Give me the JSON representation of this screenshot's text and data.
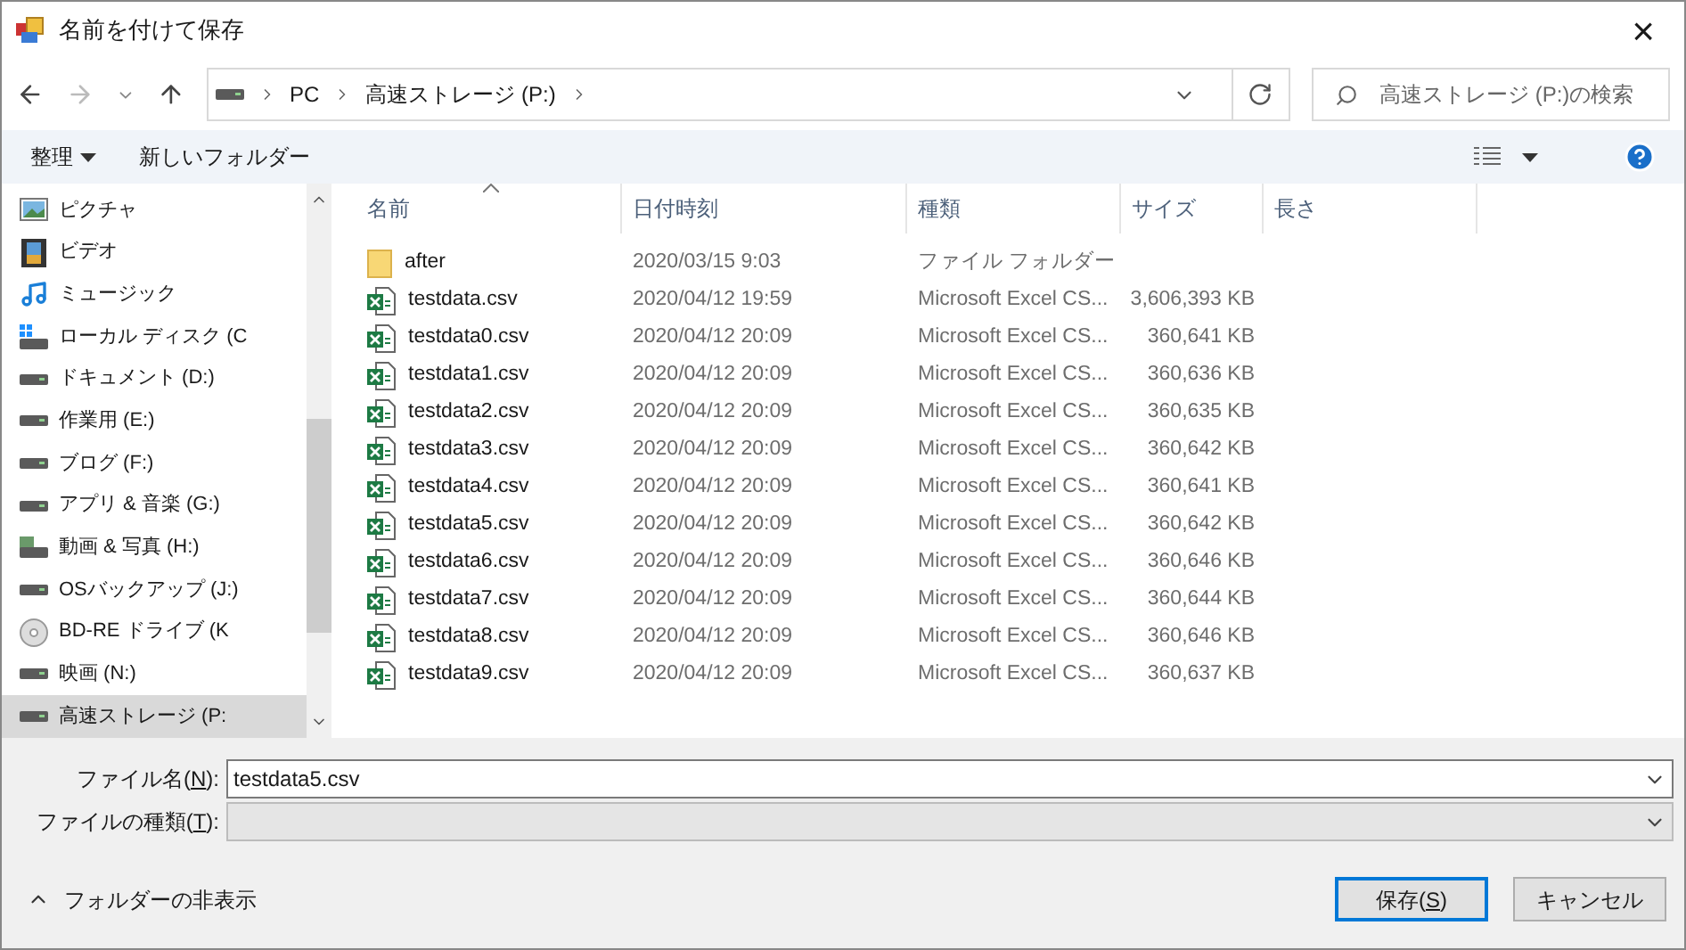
{
  "window": {
    "title": "名前を付けて保存",
    "close": "×"
  },
  "address": {
    "segments": [
      "PC",
      "高速ストレージ (P:)"
    ]
  },
  "search": {
    "placeholder": "高速ストレージ (P:)の検索"
  },
  "toolbar": {
    "organize": "整理",
    "new_folder": "新しいフォルダー"
  },
  "sidebar": {
    "items": [
      {
        "label": "ピクチャ",
        "kind": "pictures",
        "selected": false
      },
      {
        "label": "ビデオ",
        "kind": "videos",
        "selected": false
      },
      {
        "label": "ミュージック",
        "kind": "music",
        "selected": false
      },
      {
        "label": "ローカル ディスク (C",
        "kind": "system",
        "selected": false
      },
      {
        "label": "ドキュメント (D:)",
        "kind": "drive",
        "selected": false
      },
      {
        "label": "作業用 (E:)",
        "kind": "drive",
        "selected": false
      },
      {
        "label": "ブログ (F:)",
        "kind": "drive",
        "selected": false
      },
      {
        "label": "アプリ & 音楽 (G:)",
        "kind": "drive",
        "selected": false
      },
      {
        "label": "動画 & 写真 (H:)",
        "kind": "media",
        "selected": false
      },
      {
        "label": "OSバックアップ (J:)",
        "kind": "drive",
        "selected": false
      },
      {
        "label": "BD-RE ドライブ (K",
        "kind": "disc",
        "selected": false
      },
      {
        "label": "映画 (N:)",
        "kind": "drive",
        "selected": false
      },
      {
        "label": "高速ストレージ (P:",
        "kind": "drive",
        "selected": true
      }
    ]
  },
  "table": {
    "columns": [
      "名前",
      "日付時刻",
      "種類",
      "サイズ",
      "長さ"
    ],
    "rows": [
      {
        "kind": "folder",
        "name": "after",
        "date": "2020/03/15 9:03",
        "type": "ファイル フォルダー"
      },
      {
        "kind": "csv",
        "name": "testdata.csv",
        "date": "2020/04/12 19:59",
        "type": "Microsoft Excel CS...",
        "size": "3,606,393 KB"
      },
      {
        "kind": "csv",
        "name": "testdata0.csv",
        "date": "2020/04/12 20:09",
        "type": "Microsoft Excel CS...",
        "size": "360,641 KB"
      },
      {
        "kind": "csv",
        "name": "testdata1.csv",
        "date": "2020/04/12 20:09",
        "type": "Microsoft Excel CS...",
        "size": "360,636 KB"
      },
      {
        "kind": "csv",
        "name": "testdata2.csv",
        "date": "2020/04/12 20:09",
        "type": "Microsoft Excel CS...",
        "size": "360,635 KB"
      },
      {
        "kind": "csv",
        "name": "testdata3.csv",
        "date": "2020/04/12 20:09",
        "type": "Microsoft Excel CS...",
        "size": "360,642 KB"
      },
      {
        "kind": "csv",
        "name": "testdata4.csv",
        "date": "2020/04/12 20:09",
        "type": "Microsoft Excel CS...",
        "size": "360,641 KB"
      },
      {
        "kind": "csv",
        "name": "testdata5.csv",
        "date": "2020/04/12 20:09",
        "type": "Microsoft Excel CS...",
        "size": "360,642 KB"
      },
      {
        "kind": "csv",
        "name": "testdata6.csv",
        "date": "2020/04/12 20:09",
        "type": "Microsoft Excel CS...",
        "size": "360,646 KB"
      },
      {
        "kind": "csv",
        "name": "testdata7.csv",
        "date": "2020/04/12 20:09",
        "type": "Microsoft Excel CS...",
        "size": "360,644 KB"
      },
      {
        "kind": "csv",
        "name": "testdata8.csv",
        "date": "2020/04/12 20:09",
        "type": "Microsoft Excel CS...",
        "size": "360,646 KB"
      },
      {
        "kind": "csv",
        "name": "testdata9.csv",
        "date": "2020/04/12 20:09",
        "type": "Microsoft Excel CS...",
        "size": "360,637 KB"
      }
    ]
  },
  "form": {
    "filename": {
      "label": [
        "ファイル名(",
        "N",
        "):"
      ],
      "value": "testdata5.csv"
    },
    "filetype": {
      "label": [
        "ファイルの種類(",
        "T",
        "):"
      ],
      "disabled": true
    }
  },
  "footer": {
    "hide_folders": "フォルダーの非表示",
    "save": [
      "保存(",
      "S",
      ")"
    ],
    "cancel": "キャンセル"
  }
}
